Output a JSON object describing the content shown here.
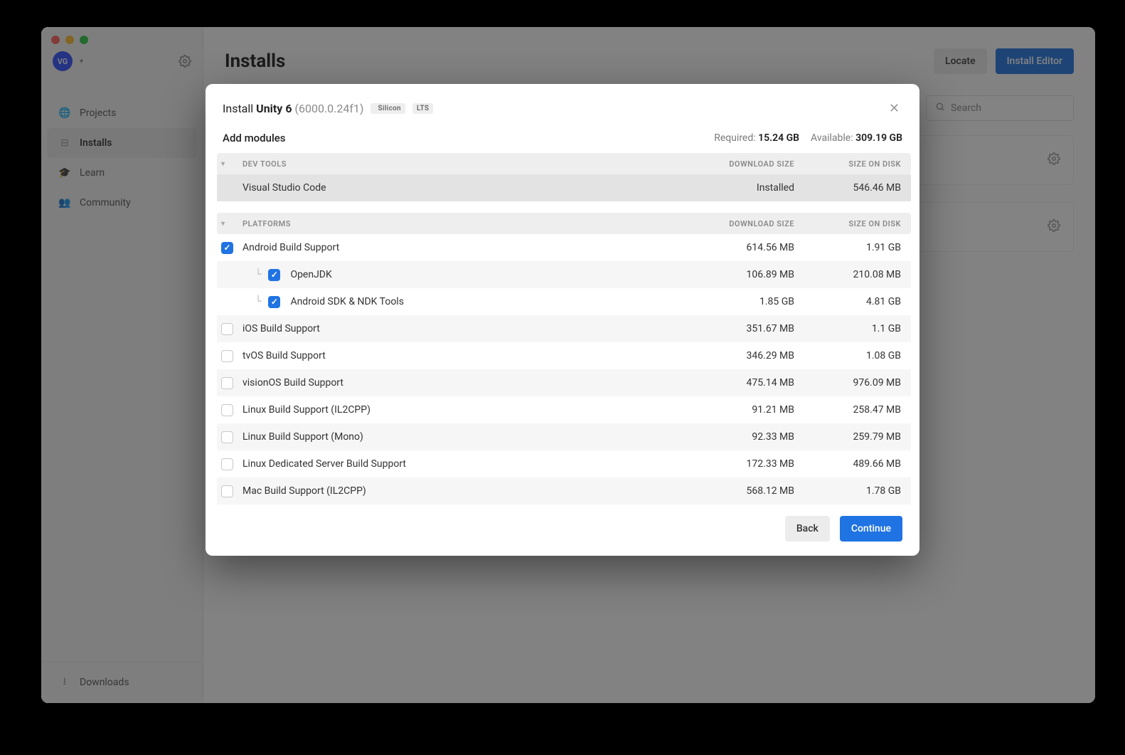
{
  "header": {
    "page_title": "Installs",
    "locate_label": "Locate",
    "install_editor_label": "Install Editor",
    "search_placeholder": "Search"
  },
  "user": {
    "initials": "VG"
  },
  "sidebar": {
    "items": [
      {
        "label": "Projects",
        "icon": "globe-icon",
        "active": false
      },
      {
        "label": "Installs",
        "icon": "download-box-icon",
        "active": true
      },
      {
        "label": "Learn",
        "icon": "graduation-icon",
        "active": false
      },
      {
        "label": "Community",
        "icon": "people-icon",
        "active": false
      }
    ],
    "downloads_label": "Downloads"
  },
  "modal": {
    "title_prefix": "Install",
    "title_product": "Unity 6",
    "title_version": "(6000.0.24f1)",
    "tag_platform": "Silicon",
    "tag_release": "LTS",
    "subtitle": "Add modules",
    "required_label": "Required:",
    "required_value": "15.24 GB",
    "available_label": "Available:",
    "available_value": "309.19 GB",
    "cols": {
      "download": "DOWNLOAD SIZE",
      "disk": "SIZE ON DISK"
    },
    "sections": [
      {
        "name": "DEV TOOLS",
        "rows": [
          {
            "name": "Visual Studio Code",
            "download": "Installed",
            "disk": "546.46 MB",
            "installed": true
          }
        ]
      },
      {
        "name": "PLATFORMS",
        "rows": [
          {
            "name": "Android Build Support",
            "download": "614.56 MB",
            "disk": "1.91 GB",
            "checked": true,
            "child": false
          },
          {
            "name": "OpenJDK",
            "download": "106.89 MB",
            "disk": "210.08 MB",
            "checked": true,
            "child": true
          },
          {
            "name": "Android SDK & NDK Tools",
            "download": "1.85 GB",
            "disk": "4.81 GB",
            "checked": true,
            "child": true
          },
          {
            "name": "iOS Build Support",
            "download": "351.67 MB",
            "disk": "1.1 GB",
            "checked": false,
            "child": false
          },
          {
            "name": "tvOS Build Support",
            "download": "346.29 MB",
            "disk": "1.08 GB",
            "checked": false,
            "child": false
          },
          {
            "name": "visionOS Build Support",
            "download": "475.14 MB",
            "disk": "976.09 MB",
            "checked": false,
            "child": false
          },
          {
            "name": "Linux Build Support (IL2CPP)",
            "download": "91.21 MB",
            "disk": "258.47 MB",
            "checked": false,
            "child": false
          },
          {
            "name": "Linux Build Support (Mono)",
            "download": "92.33 MB",
            "disk": "259.79 MB",
            "checked": false,
            "child": false
          },
          {
            "name": "Linux Dedicated Server Build Support",
            "download": "172.33 MB",
            "disk": "489.66 MB",
            "checked": false,
            "child": false
          },
          {
            "name": "Mac Build Support (IL2CPP)",
            "download": "568.12 MB",
            "disk": "1.78 GB",
            "checked": false,
            "child": false
          }
        ]
      }
    ],
    "back_label": "Back",
    "continue_label": "Continue"
  }
}
